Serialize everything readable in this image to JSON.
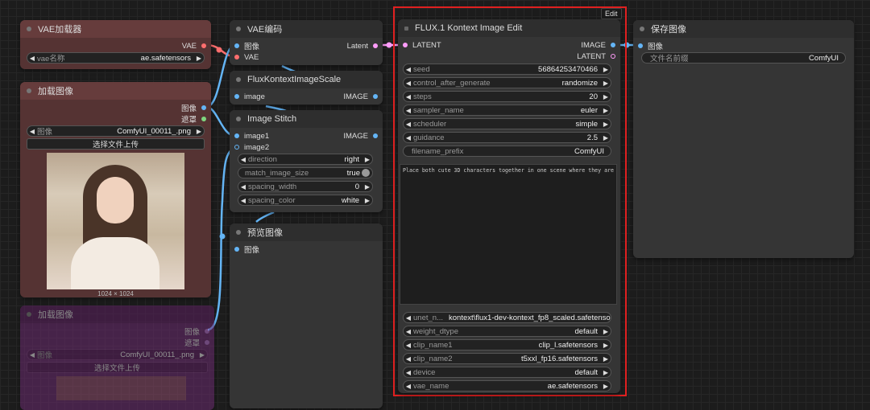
{
  "vae_loader": {
    "title": "VAE加载器",
    "output_vae": "VAE",
    "vae_name_label": "vae名称",
    "vae_name_value": "ae.safetensors"
  },
  "load_image": {
    "title": "加载图像",
    "output_image": "图像",
    "output_mask": "遮罩",
    "image_label": "图像",
    "image_value": "ComfyUI_00011_.png",
    "upload_button": "选择文件上传",
    "image_size": "1024 × 1024"
  },
  "load_image_2": {
    "title": "加载图像",
    "output_image": "图像",
    "output_mask": "遮罩",
    "image_label": "图像",
    "image_value": "ComfyUI_00011_.png",
    "upload_button": "选择文件上传"
  },
  "vae_encode": {
    "title": "VAE编码",
    "input_image": "图像",
    "input_vae": "VAE",
    "output_latent": "Latent"
  },
  "flux_scale": {
    "title": "FluxKontextImageScale",
    "input_image": "image",
    "output_image": "IMAGE"
  },
  "image_stitch": {
    "title": "Image Stitch",
    "input_image1": "image1",
    "input_image2": "image2",
    "output_image": "IMAGE",
    "widgets": [
      {
        "label": "direction",
        "value": "right"
      },
      {
        "label": "match_image_size",
        "value": "true"
      },
      {
        "label": "spacing_width",
        "value": "0"
      },
      {
        "label": "spacing_color",
        "value": "white"
      }
    ]
  },
  "preview_image": {
    "title": "预览图像",
    "input_image": "图像"
  },
  "flux_edit": {
    "badge": "Edit",
    "title": "FLUX.1 Kontext Image Edit",
    "input_latent": "LATENT",
    "output_image": "IMAGE",
    "output_latent": "LATENT",
    "widgets": [
      {
        "label": "seed",
        "value": "568642534704​66"
      },
      {
        "label": "control_after_generate",
        "value": "randomize"
      },
      {
        "label": "steps",
        "value": "20"
      },
      {
        "label": "sampler_name",
        "value": "euler"
      },
      {
        "label": "scheduler",
        "value": "simple"
      },
      {
        "label": "guidance",
        "value": "2.5"
      }
    ],
    "filename_prefix_label": "filename_prefix",
    "filename_prefix_value": "ComfyUI",
    "prompt": "Place both cute 3D characters together in one scene where they are hugging",
    "bottom_widgets": [
      {
        "label": "unet_n...",
        "value": "kontext\\flux1-dev-kontext_fp8_scaled.safetensors"
      },
      {
        "label": "weight_dtype",
        "value": "default"
      },
      {
        "label": "clip_name1",
        "value": "clip_l.safetensors"
      },
      {
        "label": "clip_name2",
        "value": "t5xxl_fp16.safetensors"
      },
      {
        "label": "device",
        "value": "default"
      },
      {
        "label": "vae_name",
        "value": "ae.safetensors"
      }
    ]
  },
  "save_image": {
    "title": "保存图像",
    "input_image": "图像",
    "filename_prefix_label": "文件名前缀",
    "filename_prefix_value": "ComfyUI"
  },
  "colors": {
    "highlight": "#e02020",
    "image_slot": "#64b5f6",
    "latent_slot": "#ff9cf9",
    "vae_slot": "#ff6e6e"
  }
}
